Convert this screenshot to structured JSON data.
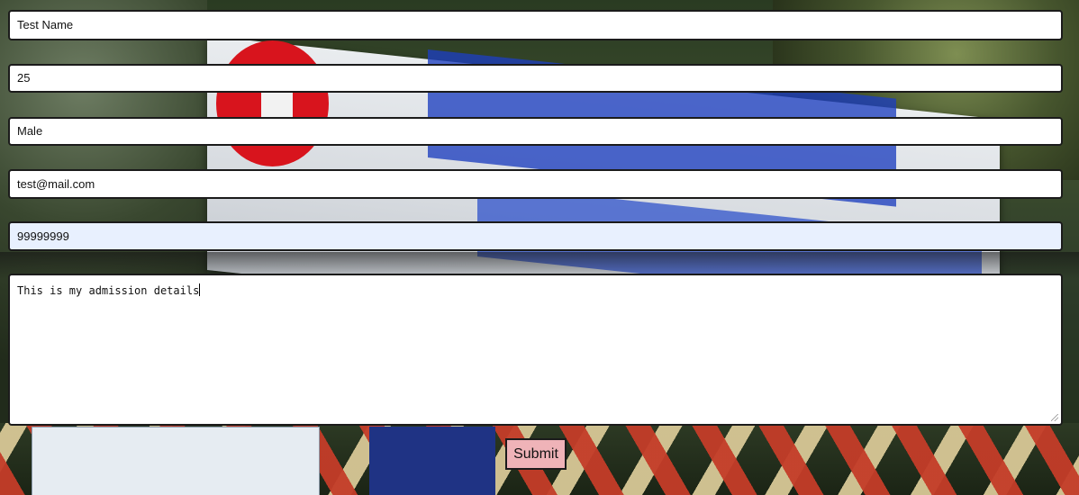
{
  "form": {
    "name_value": "Test Name",
    "age_value": "25",
    "gender_value": "Male",
    "email_value": "test@mail.com",
    "phone_value": "99999999",
    "message_value": "This is my admission details",
    "submit_label": "Submit"
  },
  "colors": {
    "autofill_background": "#e8f0fe",
    "submit_background": "#efb3b8",
    "field_border": "#1b1b1b"
  }
}
